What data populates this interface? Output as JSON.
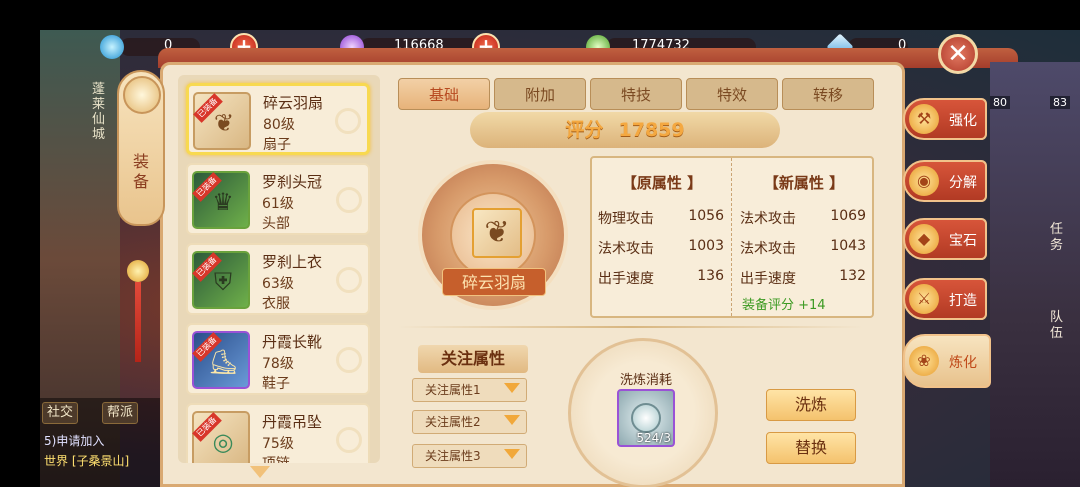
{
  "colors": {
    "accent": "#c65f2c",
    "gold": "#f4a840",
    "green_bonus": "#3c9a22",
    "panel_bg": "#f3e6cf"
  },
  "resources": [
    {
      "icon": "blue-orb-icon",
      "value": "0"
    },
    {
      "icon": "purple-orb-icon",
      "value": "116668"
    },
    {
      "icon": "green-orb-icon",
      "value": "1774732"
    },
    {
      "icon": "diamond-icon",
      "value": "0"
    }
  ],
  "left_tab": {
    "label": "装备"
  },
  "map": {
    "city": "蓬莱仙城"
  },
  "chat": {
    "buttons": [
      "社交",
      "帮派"
    ],
    "line1": "5)申请加入",
    "line2": "世界 [子桑景山]"
  },
  "items": [
    {
      "badge": "已装备",
      "name": "碎云羽扇",
      "level": "80级",
      "type": "扇子",
      "icon": "fan-icon",
      "selected": true
    },
    {
      "badge": "已装备",
      "name": "罗刹头冠",
      "level": "61级",
      "type": "头部",
      "icon": "helmet-icon"
    },
    {
      "badge": "已装备",
      "name": "罗刹上衣",
      "level": "63级",
      "type": "衣服",
      "icon": "armor-icon"
    },
    {
      "badge": "已装备",
      "name": "丹霞长靴",
      "level": "78级",
      "type": "鞋子",
      "icon": "boots-icon"
    },
    {
      "badge": "已装备",
      "name": "丹霞吊坠",
      "level": "75级",
      "type": "项链",
      "icon": "pendant-icon"
    }
  ],
  "tabs": [
    "基础",
    "附加",
    "特技",
    "特效",
    "转移"
  ],
  "active_tab": "基础",
  "score": {
    "label": "评分",
    "value": "17859"
  },
  "featured_item": {
    "name": "碎云羽扇",
    "icon": "fan-icon"
  },
  "stats": {
    "original_header": "【原属性 】",
    "new_header": "【新属性 】",
    "original": [
      {
        "name": "物理攻击",
        "value": "1056"
      },
      {
        "name": "法术攻击",
        "value": "1003"
      },
      {
        "name": "出手速度",
        "value": "136"
      }
    ],
    "new": [
      {
        "name": "法术攻击",
        "value": "1069"
      },
      {
        "name": "法术攻击",
        "value": "1043"
      },
      {
        "name": "出手速度",
        "value": "132"
      }
    ],
    "bonus": "装备评分 +14"
  },
  "follow": {
    "title": "关注属性",
    "options": [
      "关注属性1",
      "关注属性2",
      "关注属性3"
    ]
  },
  "refine": {
    "title": "洗炼消耗",
    "count": "524/3",
    "icon": "refine-stone-icon"
  },
  "actions": {
    "refine": "洗炼",
    "replace": "替换"
  },
  "side_tabs": [
    {
      "label": "强化",
      "icon": "hammer-icon"
    },
    {
      "label": "分解",
      "icon": "cauldron-icon"
    },
    {
      "label": "宝石",
      "icon": "gem-icon"
    },
    {
      "label": "打造",
      "icon": "anvil-icon"
    },
    {
      "label": "炼化",
      "icon": "lotus-icon",
      "active": true
    }
  ],
  "right_map": {
    "level1": "80",
    "level2": "83",
    "task": "任务",
    "team": "队伍"
  }
}
